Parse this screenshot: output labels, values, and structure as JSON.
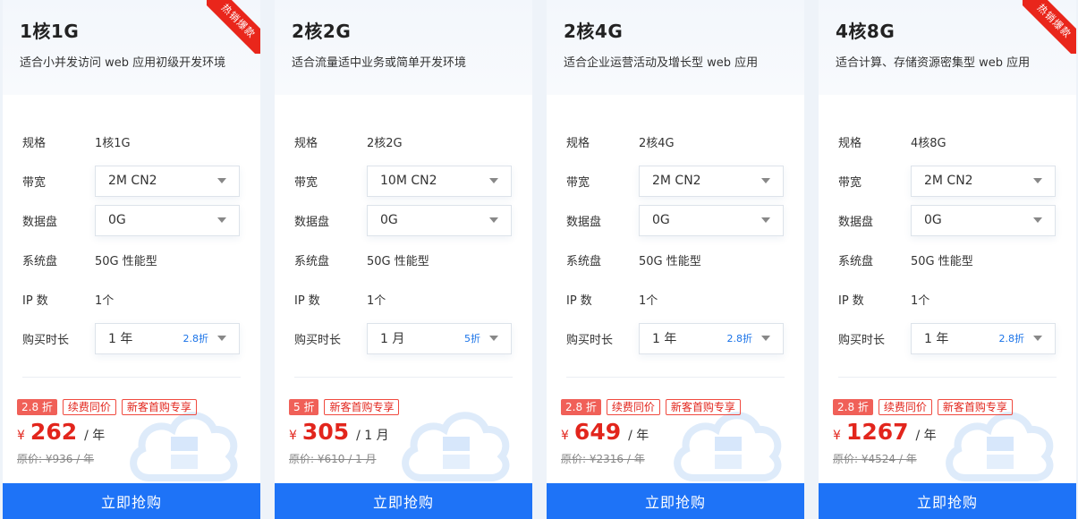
{
  "cards": [
    {
      "title": "1核1G",
      "desc": "适合小并发访问 web 应用初级开发环境",
      "ribbon": "热销爆款",
      "spec_label": "规格",
      "spec_value": "1核1G",
      "bandwidth_label": "带宽",
      "bandwidth_value": "2M CN2",
      "disk_label": "数据盘",
      "disk_value": "0G",
      "sysdisk_label": "系统盘",
      "sysdisk_value": "50G 性能型",
      "ip_label": "IP 数",
      "ip_value": "1个",
      "duration_label": "购买时长",
      "duration_value": "1 年",
      "duration_discount": "2.8折",
      "tags": [
        "2.8 折",
        "续费同价",
        "新客首购专享"
      ],
      "currency": "¥",
      "price": "262",
      "unit": "/ 年",
      "original": "原价: ¥936 / 年",
      "buy_label": "立即抢购"
    },
    {
      "title": "2核2G",
      "desc": "适合流量适中业务或简单开发环境",
      "ribbon": "",
      "spec_label": "规格",
      "spec_value": "2核2G",
      "bandwidth_label": "带宽",
      "bandwidth_value": "10M CN2",
      "disk_label": "数据盘",
      "disk_value": "0G",
      "sysdisk_label": "系统盘",
      "sysdisk_value": "50G 性能型",
      "ip_label": "IP 数",
      "ip_value": "1个",
      "duration_label": "购买时长",
      "duration_value": "1 月",
      "duration_discount": "5折",
      "tags": [
        "5 折",
        "新客首购专享"
      ],
      "currency": "¥",
      "price": "305",
      "unit": "/ 1 月",
      "original": "原价: ¥610 / 1 月",
      "buy_label": "立即抢购"
    },
    {
      "title": "2核4G",
      "desc": "适合企业运营活动及增长型 web 应用",
      "ribbon": "",
      "spec_label": "规格",
      "spec_value": "2核4G",
      "bandwidth_label": "带宽",
      "bandwidth_value": "2M CN2",
      "disk_label": "数据盘",
      "disk_value": "0G",
      "sysdisk_label": "系统盘",
      "sysdisk_value": "50G 性能型",
      "ip_label": "IP 数",
      "ip_value": "1个",
      "duration_label": "购买时长",
      "duration_value": "1 年",
      "duration_discount": "2.8折",
      "tags": [
        "2.8 折",
        "续费同价",
        "新客首购专享"
      ],
      "currency": "¥",
      "price": "649",
      "unit": "/ 年",
      "original": "原价: ¥2316 / 年",
      "buy_label": "立即抢购"
    },
    {
      "title": "4核8G",
      "desc": "适合计算、存储资源密集型 web 应用",
      "ribbon": "热销爆款",
      "spec_label": "规格",
      "spec_value": "4核8G",
      "bandwidth_label": "带宽",
      "bandwidth_value": "2M CN2",
      "disk_label": "数据盘",
      "disk_value": "0G",
      "sysdisk_label": "系统盘",
      "sysdisk_value": "50G 性能型",
      "ip_label": "IP 数",
      "ip_value": "1个",
      "duration_label": "购买时长",
      "duration_value": "1 年",
      "duration_discount": "2.8折",
      "tags": [
        "2.8 折",
        "续费同价",
        "新客首购专享"
      ],
      "currency": "¥",
      "price": "1267",
      "unit": "/ 年",
      "original": "原价: ¥4524 / 年",
      "buy_label": "立即抢购"
    }
  ],
  "colors": {
    "accent": "#1e73f7",
    "price": "#e2251c",
    "ribbon": "#e9261b"
  }
}
